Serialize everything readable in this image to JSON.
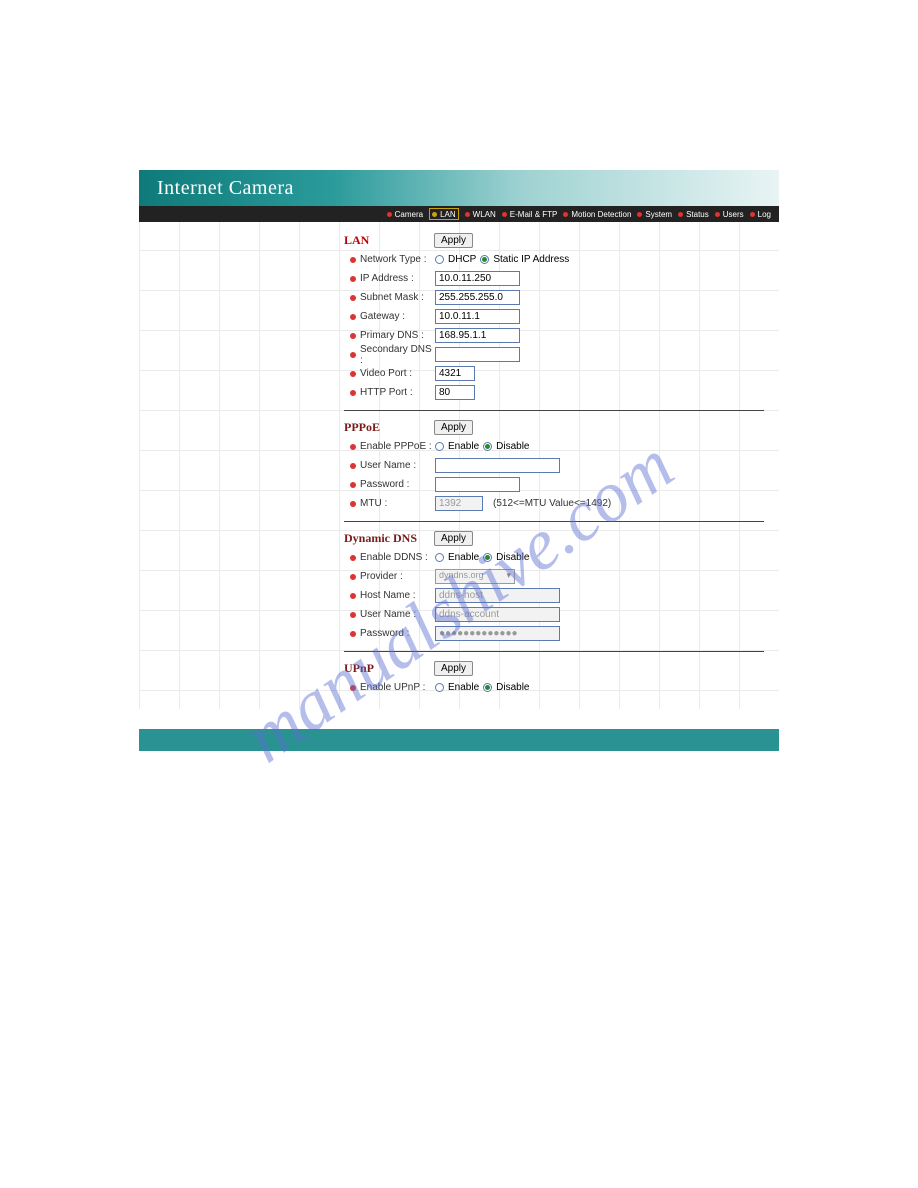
{
  "header": {
    "title": "Internet Camera"
  },
  "nav": {
    "items": [
      {
        "label": "Camera",
        "active": false
      },
      {
        "label": "LAN",
        "active": true
      },
      {
        "label": "WLAN",
        "active": false
      },
      {
        "label": "E-Mail & FTP",
        "active": false
      },
      {
        "label": "Motion Detection",
        "active": false
      },
      {
        "label": "System",
        "active": false
      },
      {
        "label": "Status",
        "active": false
      },
      {
        "label": "Users",
        "active": false
      },
      {
        "label": "Log",
        "active": false
      }
    ]
  },
  "apply_label": "Apply",
  "lan": {
    "title": "LAN",
    "network_type_label": "Network Type :",
    "dhcp": "DHCP",
    "static": "Static IP Address",
    "ip_label": "IP Address :",
    "ip_value": "10.0.11.250",
    "subnet_label": "Subnet Mask :",
    "subnet_value": "255.255.255.0",
    "gateway_label": "Gateway :",
    "gateway_value": "10.0.11.1",
    "pdns_label": "Primary DNS :",
    "pdns_value": "168.95.1.1",
    "sdns_label": "Secondary DNS :",
    "sdns_value": "",
    "video_port_label": "Video Port :",
    "video_port_value": "4321",
    "http_port_label": "HTTP Port :",
    "http_port_value": "80"
  },
  "pppoe": {
    "title": "PPPoE",
    "enable_label": "Enable PPPoE :",
    "enable": "Enable",
    "disable": "Disable",
    "user_label": "User Name :",
    "user_value": "",
    "pass_label": "Password :",
    "pass_value": "",
    "mtu_label": "MTU :",
    "mtu_value": "1392",
    "mtu_hint": "(512<=MTU Value<=1492)"
  },
  "ddns": {
    "title": "Dynamic DNS",
    "enable_label": "Enable DDNS :",
    "enable": "Enable",
    "disable": "Disable",
    "provider_label": "Provider :",
    "provider_value": "dyndns.org",
    "host_label": "Host Name :",
    "host_value": "ddns-host",
    "user_label": "User Name :",
    "user_value": "ddns-account",
    "pass_label": "Password :",
    "pass_value": "●●●●●●●●●●●●●"
  },
  "upnp": {
    "title": "UPnP",
    "enable_label": "Enable UPnP :",
    "enable": "Enable",
    "disable": "Disable"
  },
  "watermark": "manualshive.com"
}
